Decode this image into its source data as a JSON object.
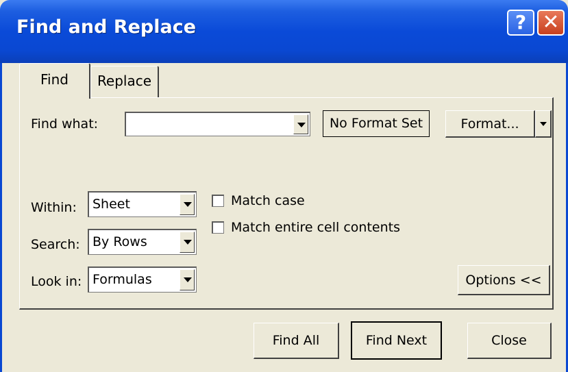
{
  "window": {
    "title": "Find and Replace",
    "help_glyph": "?",
    "close_glyph": "✕"
  },
  "tabs": [
    {
      "label": "Find",
      "active": true
    },
    {
      "label": "Replace",
      "active": false
    }
  ],
  "find_what": {
    "label": "Find what:",
    "value": ""
  },
  "format_status": "No Format Set",
  "format_button": "Format...",
  "within": {
    "label": "Within:",
    "value": "Sheet"
  },
  "search": {
    "label": "Search:",
    "value": "By Rows"
  },
  "look_in": {
    "label": "Look in:",
    "value": "Formulas"
  },
  "match_case": {
    "label": "Match case",
    "checked": false
  },
  "match_entire": {
    "label": "Match entire cell contents",
    "checked": false
  },
  "options_button": "Options <<",
  "buttons": {
    "find_all": "Find All",
    "find_next": "Find Next",
    "close": "Close"
  },
  "colors": {
    "title_bar": "#0a48d2",
    "dialog_bg": "#ece9d8",
    "close_button": "#c8401e"
  }
}
